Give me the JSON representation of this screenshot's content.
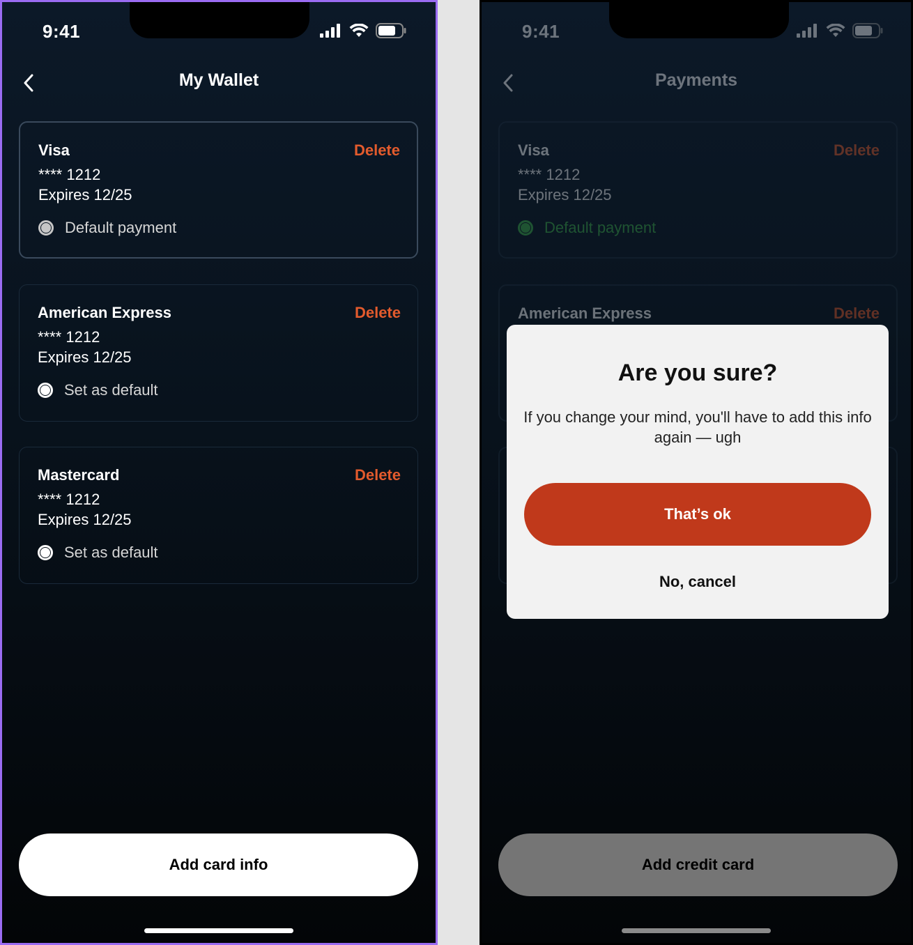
{
  "status_bar": {
    "time": "9:41"
  },
  "left": {
    "title": "My Wallet",
    "cards": [
      {
        "name": "Visa",
        "number": "**** 1212",
        "expiry": "Expires 12/25",
        "radio_label": "Default payment",
        "delete_label": "Delete"
      },
      {
        "name": "American Express",
        "number": "**** 1212",
        "expiry": "Expires 12/25",
        "radio_label": "Set as default",
        "delete_label": "Delete"
      },
      {
        "name": "Mastercard",
        "number": "**** 1212",
        "expiry": "Expires 12/25",
        "radio_label": "Set as default",
        "delete_label": "Delete"
      }
    ],
    "primary_button": "Add card info"
  },
  "right": {
    "title": "Payments",
    "cards": [
      {
        "name": "Visa",
        "number": "**** 1212",
        "expiry": "Expires 12/25",
        "radio_label": "Default payment",
        "delete_label": "Delete"
      },
      {
        "name": "American Express",
        "delete_label": "Delete"
      }
    ],
    "primary_button": "Add credit card",
    "modal": {
      "title": "Are you sure?",
      "body": "If you change your mind, you'll have to add this info again — ugh",
      "confirm": "That’s ok",
      "cancel": "No, cancel"
    }
  },
  "colors": {
    "accent_delete": "#e35b2d",
    "confirm_button": "#c0391b",
    "default_green": "#3fb14a",
    "selection_border": "#9b6cf2"
  },
  "icons": [
    "chevron-left-icon",
    "cellular-signal-icon",
    "wifi-icon",
    "battery-icon",
    "radio-button-icon"
  ]
}
